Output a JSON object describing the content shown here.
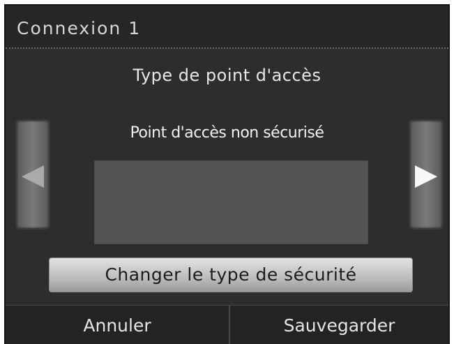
{
  "window": {
    "title": "Connexion 1"
  },
  "main": {
    "heading": "Type de point d'accès",
    "access_point_type": "Point d'accès non sécurisé",
    "change_security_label": "Changer le type de sécurité"
  },
  "navigation": {
    "prev_icon": "left-arrow-icon",
    "next_icon": "right-arrow-icon"
  },
  "footer": {
    "cancel_label": "Annuler",
    "save_label": "Sauvegarder"
  }
}
